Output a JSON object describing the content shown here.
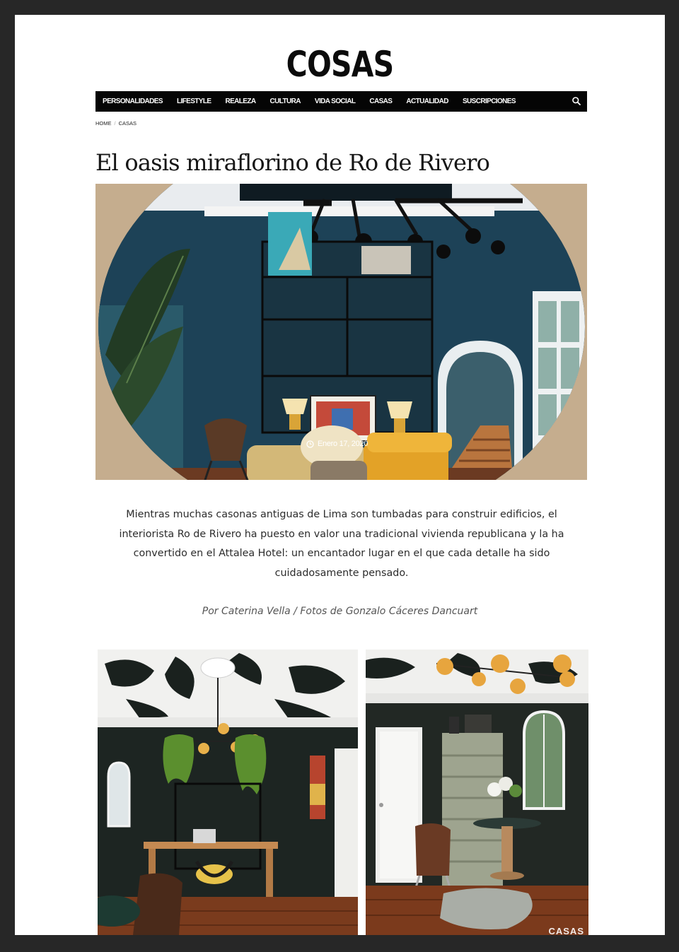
{
  "brand": {
    "logo": "COSAS"
  },
  "nav": {
    "items": [
      "PERSONALIDADES",
      "LIFESTYLE",
      "REALEZA",
      "CULTURA",
      "VIDA SOCIAL",
      "CASAS",
      "ACTUALIDAD",
      "SUSCRIPCIONES"
    ],
    "search_icon": "search-icon"
  },
  "breadcrumb": {
    "home": "HOME",
    "separator": "/",
    "section": "CASAS"
  },
  "article": {
    "title": "El oasis miraflorino de Ro de Rivero",
    "date": "Enero 17, 2020",
    "lead": "Mientras muchas casonas antiguas de Lima son tumbadas para construir edificios, el interiorista Ro de Rivero ha puesto en valor una tradicional vivienda republicana y la ha convertido en el Attalea Hotel: un encantador lugar en el que cada detalle ha sido cuidadosamente pensado.",
    "credits": "Por Caterina Vella / Fotos de Gonzalo Cáceres Dancuart"
  },
  "photos": {
    "watermark": "CASAS"
  },
  "colors": {
    "nav_bg": "#050505",
    "page_bg": "#272727",
    "hero_frame": "#c5ad8e",
    "wall_blue": "#1d4257"
  }
}
